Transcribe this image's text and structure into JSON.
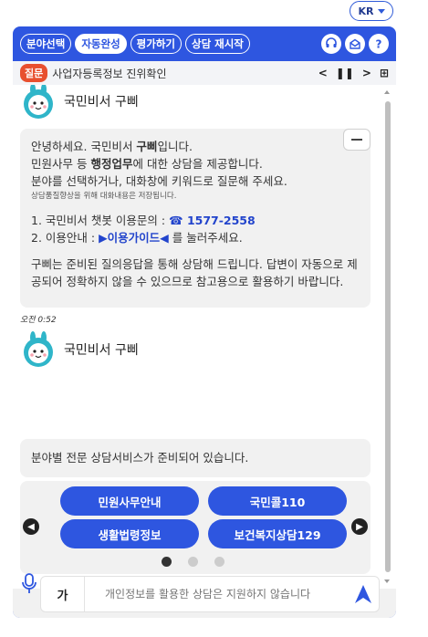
{
  "lang": {
    "label": "KR"
  },
  "topbar": {
    "tabs": [
      "분야선택",
      "자동완성",
      "평가하기",
      "상담 재시작"
    ]
  },
  "question_bar": {
    "badge": "질문",
    "text": "사업자등록정보 진위확인"
  },
  "message1": {
    "bot_name": "국민비서 구삐",
    "line1_pre": "안녕하세요. 국민비서 ",
    "line1_bold": "구삐",
    "line1_post": "입니다.",
    "line2_pre": "민원사무 등 ",
    "line2_bold": "행정업무",
    "line2_post": "에 대한 상담을 제공합니다.",
    "line3": "분야를 선택하거나, 대화창에 키워드로 질문해 주세요.",
    "small_note": "상담품질향상을 위해 대화내용은 저장됩니다.",
    "contact_label": "1. 국민비서 챗봇 이용문의 : ",
    "phone": "☎ 1577-2558",
    "guide_pre": "2. 이용안내 : ",
    "guide_link": "▶이용가이드◀",
    "guide_post": " 를 눌러주세요.",
    "notice": "구삐는 준비된 질의응답을 통해 상담해 드립니다. 답변이 자동으로 제공되어 정확하지 않을 수 있으므로 참고용으로 활용하기 바랍니다."
  },
  "timestamp": "오전 0:52",
  "message2": {
    "bot_name": "국민비서 구삐",
    "text": "분야별 전문 상담서비스가 준비되어 있습니다."
  },
  "carousel": {
    "buttons": [
      "민원사무안내",
      "국민콜110",
      "생활법령정보",
      "보건복지상담129"
    ],
    "active_page": 1,
    "page_count": 3
  },
  "input": {
    "mode_label": "가",
    "placeholder": "개인정보를 활용한 상담은 지원하지 않습니다"
  },
  "colors": {
    "accent": "#2e56e0",
    "badge": "#e8502f"
  }
}
